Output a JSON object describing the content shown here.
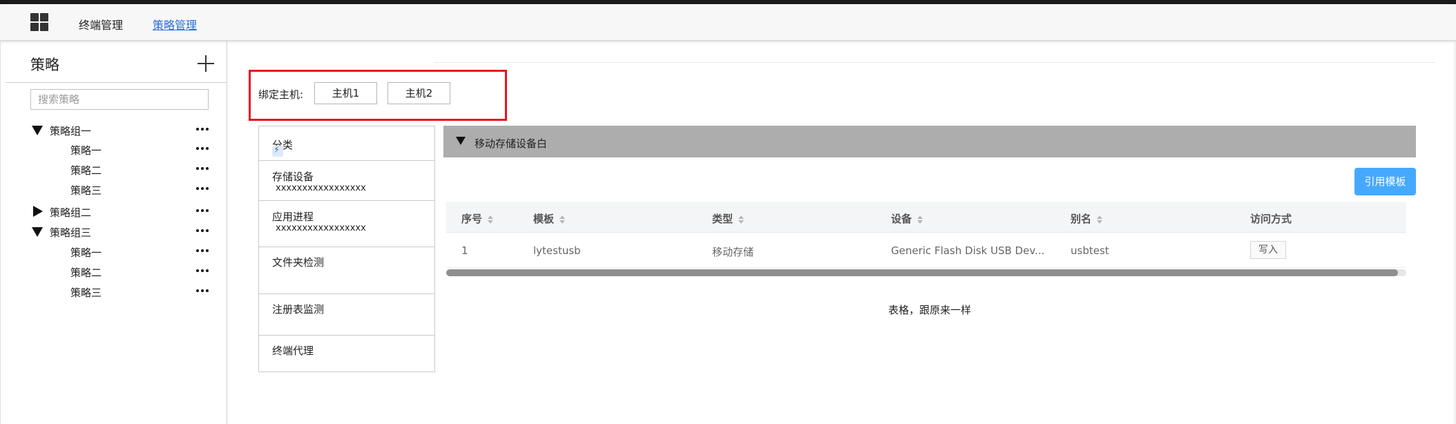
{
  "nav": {
    "menu_icon": "grid-icon",
    "items": [
      {
        "label": "终端管理",
        "active": false
      },
      {
        "label": "策略管理",
        "active": true
      }
    ],
    "active_color": "#2b6cd3"
  },
  "sidebar": {
    "title": "策略",
    "add_icon": "plus-icon",
    "search_placeholder": "搜索策略",
    "tree": [
      {
        "label": "策略组一",
        "expanded": true,
        "children": [
          "策略一",
          "策略二",
          "策略三"
        ]
      },
      {
        "label": "策略组二",
        "expanded": false,
        "children": []
      },
      {
        "label": "策略组三",
        "expanded": true,
        "children": [
          "策略一",
          "策略二",
          "策略三"
        ]
      }
    ],
    "more_icon": "more-dots-icon"
  },
  "bind_hosts": {
    "label": "绑定主机:",
    "hosts": [
      "主机1",
      "主机2"
    ],
    "highlight_color": "#e8141c"
  },
  "categories": {
    "header": "分类",
    "header_icon": "lightning-icon",
    "items": [
      {
        "title": "存储设备",
        "subtitle": "xxxxxxxxxxxxxxxxx"
      },
      {
        "title": "应用进程",
        "subtitle": "xxxxxxxxxxxxxxxxx"
      },
      {
        "title": "文件夹检测",
        "subtitle": ""
      },
      {
        "title": "注册表监测",
        "subtitle": ""
      },
      {
        "title": "终端代理",
        "subtitle": ""
      }
    ]
  },
  "section": {
    "title": "移动存储设备白",
    "expanded": true,
    "bar_color": "#adadad"
  },
  "actions": {
    "reference_template": "引用模板",
    "button_color": "#45a9ff"
  },
  "table": {
    "columns": [
      "序号",
      "模板",
      "类型",
      "设备",
      "别名",
      "访问方式"
    ],
    "sortable": [
      true,
      true,
      true,
      true,
      true,
      false
    ],
    "rows": [
      {
        "index": "1",
        "template": "lytestusb",
        "type": "移动存储",
        "device": "Generic Flash Disk USB Dev...",
        "alias": "usbtest",
        "access": "写入"
      }
    ]
  },
  "note": "表格，跟原来一样"
}
